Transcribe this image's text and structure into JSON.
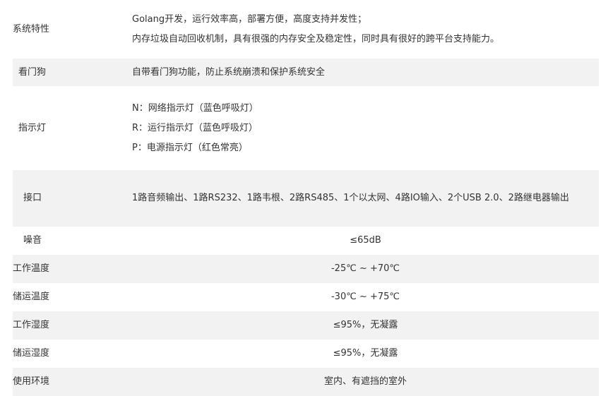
{
  "specs": {
    "features": {
      "label": "系统特性",
      "lines": [
        "Golang开发，运行效率高，部署方便，高度支持并发性；",
        "内存垃圾自动回收机制，具有很强的内存安全及稳定性，同时具有很好的跨平台支持能力。"
      ]
    },
    "watchdog": {
      "label": "看门狗",
      "value": "自带看门狗功能，防止系统崩溃和保护系统安全"
    },
    "indicators": {
      "label": "指示灯",
      "lines": [
        "N：网络指示灯（蓝色呼吸灯）",
        "R：运行指示灯（蓝色呼吸灯）",
        "P：电源指示灯（红色常亮）"
      ]
    },
    "interface": {
      "label": "接口",
      "value": "1路音频输出、1路RS232、1路韦根、2路RS485、1个以太网、4路IO输入、2个USB 2.0、2路继电器输出"
    },
    "noise": {
      "label": "噪音",
      "value": "≤65dB"
    },
    "operating_temperature": {
      "label": "工作温度",
      "value": "-25℃ ~ +70℃"
    },
    "storage_temperature": {
      "label": "储运温度",
      "value": "-30℃ ~ +75℃"
    },
    "operating_humidity": {
      "label": "工作湿度",
      "value": "≤95%，无凝露"
    },
    "storage_humidity": {
      "label": "储运湿度",
      "value": "≤95%，无凝露"
    },
    "environment": {
      "label": "使用环境",
      "value": "室内、有遮挡的室外"
    }
  }
}
